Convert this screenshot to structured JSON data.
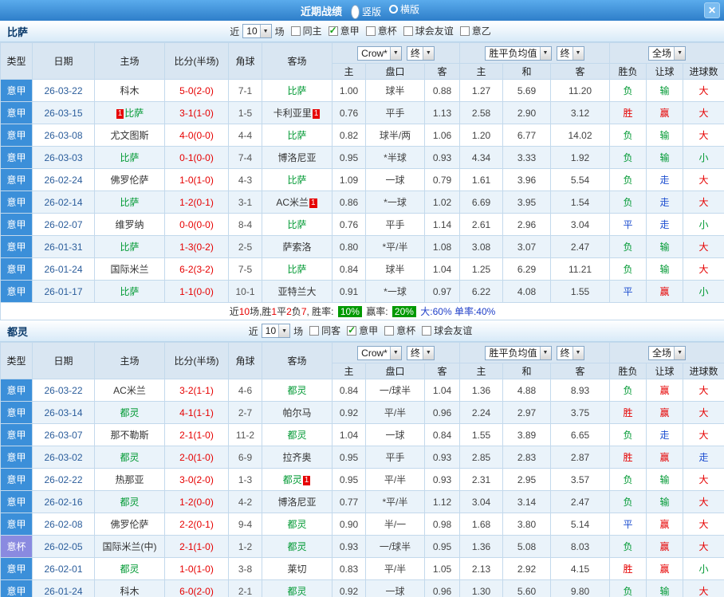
{
  "titlebar": {
    "title": "近期战绩",
    "layout_options": [
      {
        "label": "竖版",
        "selected": true
      },
      {
        "label": "横版",
        "selected": false
      }
    ],
    "close": "✕"
  },
  "colors": {
    "titlebar_blue": "#2e7ec9",
    "league_badge_blue": "#3b8fd9",
    "cup_badge_purple": "#8a8ae0",
    "focus_team_green": "#009933",
    "win_red": "#e60000",
    "loss_green": "#009933",
    "draw_blue": "#1e4fd0",
    "rate_badge_green": "#009900"
  },
  "sections": [
    {
      "team": "比萨",
      "filter": {
        "near": "近",
        "count": "10",
        "unit": "场",
        "checkboxes": [
          {
            "label": "同主",
            "checked": false
          },
          {
            "label": "意甲",
            "checked": true
          },
          {
            "label": "意杯",
            "checked": false
          },
          {
            "label": "球会友谊",
            "checked": false
          },
          {
            "label": "意乙",
            "checked": false
          }
        ]
      },
      "table": {
        "cols": [
          "类型",
          "日期",
          "主场",
          "比分(半场)",
          "角球",
          "客场"
        ],
        "odds_group": {
          "select": "Crow*",
          "final": "终",
          "cols": [
            "主",
            "盘口",
            "客"
          ]
        },
        "avg_group": {
          "select": "胜平负均值",
          "final": "终",
          "cols": [
            "主",
            "和",
            "客"
          ]
        },
        "full_group": {
          "select": "全场",
          "cols": [
            "胜负",
            "让球",
            "进球数"
          ]
        },
        "rows": [
          {
            "league": "意甲",
            "date": "26-03-22",
            "home": "科木",
            "score": "5-0(2-0)",
            "corner": "7-1",
            "away": "比萨",
            "af": true,
            "odds": [
              "1.00",
              "球半",
              "0.88"
            ],
            "avg": [
              "1.27",
              "5.69",
              "11.20"
            ],
            "res": [
              "负",
              "g"
            ],
            "let": [
              "输",
              "g"
            ],
            "big": [
              "大",
              "r"
            ]
          },
          {
            "league": "意甲",
            "date": "26-03-15",
            "home": "比萨",
            "hf": true,
            "hb_before": "1",
            "score": "3-1(1-0)",
            "corner": "1-5",
            "away": "卡利亚里",
            "ab_after": "1",
            "odds": [
              "0.76",
              "平手",
              "1.13"
            ],
            "avg": [
              "2.58",
              "2.90",
              "3.12"
            ],
            "res": [
              "胜",
              "r"
            ],
            "let": [
              "赢",
              "r"
            ],
            "big": [
              "大",
              "r"
            ]
          },
          {
            "league": "意甲",
            "date": "26-03-08",
            "home": "尤文图斯",
            "score": "4-0(0-0)",
            "corner": "4-4",
            "away": "比萨",
            "af": true,
            "odds": [
              "0.82",
              "球半/两",
              "1.06"
            ],
            "avg": [
              "1.20",
              "6.77",
              "14.02"
            ],
            "res": [
              "负",
              "g"
            ],
            "let": [
              "输",
              "g"
            ],
            "big": [
              "大",
              "r"
            ]
          },
          {
            "league": "意甲",
            "date": "26-03-03",
            "home": "比萨",
            "hf": true,
            "score": "0-1(0-0)",
            "corner": "7-4",
            "away": "博洛尼亚",
            "odds": [
              "0.95",
              "*半球",
              "0.93"
            ],
            "avg": [
              "4.34",
              "3.33",
              "1.92"
            ],
            "res": [
              "负",
              "g"
            ],
            "let": [
              "输",
              "g"
            ],
            "big": [
              "小",
              "g"
            ]
          },
          {
            "league": "意甲",
            "date": "26-02-24",
            "home": "佛罗伦萨",
            "score": "1-0(1-0)",
            "corner": "4-3",
            "away": "比萨",
            "af": true,
            "odds": [
              "1.09",
              "一球",
              "0.79"
            ],
            "avg": [
              "1.61",
              "3.96",
              "5.54"
            ],
            "res": [
              "负",
              "g"
            ],
            "let": [
              "走",
              "b"
            ],
            "big": [
              "大",
              "r"
            ]
          },
          {
            "league": "意甲",
            "date": "26-02-14",
            "home": "比萨",
            "hf": true,
            "score": "1-2(0-1)",
            "corner": "3-1",
            "away": "AC米兰",
            "ab_after": "1",
            "odds": [
              "0.86",
              "*一球",
              "1.02"
            ],
            "avg": [
              "6.69",
              "3.95",
              "1.54"
            ],
            "res": [
              "负",
              "g"
            ],
            "let": [
              "走",
              "b"
            ],
            "big": [
              "大",
              "r"
            ]
          },
          {
            "league": "意甲",
            "date": "26-02-07",
            "home": "维罗纳",
            "score": "0-0(0-0)",
            "corner": "8-4",
            "away": "比萨",
            "af": true,
            "odds": [
              "0.76",
              "平手",
              "1.14"
            ],
            "avg": [
              "2.61",
              "2.96",
              "3.04"
            ],
            "res": [
              "平",
              "b"
            ],
            "let": [
              "走",
              "b"
            ],
            "big": [
              "小",
              "g"
            ]
          },
          {
            "league": "意甲",
            "date": "26-01-31",
            "home": "比萨",
            "hf": true,
            "score": "1-3(0-2)",
            "corner": "2-5",
            "away": "萨索洛",
            "odds": [
              "0.80",
              "*平/半",
              "1.08"
            ],
            "avg": [
              "3.08",
              "3.07",
              "2.47"
            ],
            "res": [
              "负",
              "g"
            ],
            "let": [
              "输",
              "g"
            ],
            "big": [
              "大",
              "r"
            ]
          },
          {
            "league": "意甲",
            "date": "26-01-24",
            "home": "国际米兰",
            "score": "6-2(3-2)",
            "corner": "7-5",
            "away": "比萨",
            "af": true,
            "odds": [
              "0.84",
              "球半",
              "1.04"
            ],
            "avg": [
              "1.25",
              "6.29",
              "11.21"
            ],
            "res": [
              "负",
              "g"
            ],
            "let": [
              "输",
              "g"
            ],
            "big": [
              "大",
              "r"
            ]
          },
          {
            "league": "意甲",
            "date": "26-01-17",
            "home": "比萨",
            "hf": true,
            "score": "1-1(0-0)",
            "corner": "10-1",
            "away": "亚特兰大",
            "odds": [
              "0.91",
              "*一球",
              "0.97"
            ],
            "avg": [
              "6.22",
              "4.08",
              "1.55"
            ],
            "res": [
              "平",
              "b"
            ],
            "let": [
              "赢",
              "r"
            ],
            "big": [
              "小",
              "g"
            ]
          }
        ]
      },
      "summary": {
        "parts": [
          {
            "t": "近",
            "c": "k"
          },
          {
            "t": "10",
            "c": "r"
          },
          {
            "t": "场,胜",
            "c": "k"
          },
          {
            "t": "1",
            "c": "r"
          },
          {
            "t": "平",
            "c": "k"
          },
          {
            "t": "2",
            "c": "r"
          },
          {
            "t": "负",
            "c": "k"
          },
          {
            "t": "7",
            "c": "r"
          },
          {
            "t": ", 胜率: ",
            "c": "k"
          },
          {
            "t": "10%",
            "c": "badge"
          },
          {
            "t": " 赢率: ",
            "c": "k"
          },
          {
            "t": "20%",
            "c": "badge"
          },
          {
            "t": " 大:",
            "c": "bl"
          },
          {
            "t": "60%",
            "c": "bl"
          },
          {
            "t": " 单率:",
            "c": "bl"
          },
          {
            "t": "40%",
            "c": "bl"
          }
        ]
      }
    },
    {
      "team": "都灵",
      "filter": {
        "near": "近",
        "count": "10",
        "unit": "场",
        "checkboxes": [
          {
            "label": "同客",
            "checked": false
          },
          {
            "label": "意甲",
            "checked": true
          },
          {
            "label": "意杯",
            "checked": false
          },
          {
            "label": "球会友谊",
            "checked": false
          }
        ]
      },
      "table": {
        "cols": [
          "类型",
          "日期",
          "主场",
          "比分(半场)",
          "角球",
          "客场"
        ],
        "odds_group": {
          "select": "Crow*",
          "final": "终",
          "cols": [
            "主",
            "盘口",
            "客"
          ]
        },
        "avg_group": {
          "select": "胜平负均值",
          "final": "终",
          "cols": [
            "主",
            "和",
            "客"
          ]
        },
        "full_group": {
          "select": "全场",
          "cols": [
            "胜负",
            "让球",
            "进球数"
          ]
        },
        "rows": [
          {
            "league": "意甲",
            "date": "26-03-22",
            "home": "AC米兰",
            "score": "3-2(1-1)",
            "corner": "4-6",
            "away": "都灵",
            "af": true,
            "odds": [
              "0.84",
              "一/球半",
              "1.04"
            ],
            "avg": [
              "1.36",
              "4.88",
              "8.93"
            ],
            "res": [
              "负",
              "g"
            ],
            "let": [
              "赢",
              "r"
            ],
            "big": [
              "大",
              "r"
            ]
          },
          {
            "league": "意甲",
            "date": "26-03-14",
            "home": "都灵",
            "hf": true,
            "score": "4-1(1-1)",
            "corner": "2-7",
            "away": "帕尔马",
            "odds": [
              "0.92",
              "平/半",
              "0.96"
            ],
            "avg": [
              "2.24",
              "2.97",
              "3.75"
            ],
            "res": [
              "胜",
              "r"
            ],
            "let": [
              "赢",
              "r"
            ],
            "big": [
              "大",
              "r"
            ]
          },
          {
            "league": "意甲",
            "date": "26-03-07",
            "home": "那不勒斯",
            "score": "2-1(1-0)",
            "corner": "11-2",
            "away": "都灵",
            "af": true,
            "odds": [
              "1.04",
              "一球",
              "0.84"
            ],
            "avg": [
              "1.55",
              "3.89",
              "6.65"
            ],
            "res": [
              "负",
              "g"
            ],
            "let": [
              "走",
              "b"
            ],
            "big": [
              "大",
              "r"
            ]
          },
          {
            "league": "意甲",
            "date": "26-03-02",
            "home": "都灵",
            "hf": true,
            "score": "2-0(1-0)",
            "corner": "6-9",
            "away": "拉齐奥",
            "odds": [
              "0.95",
              "平手",
              "0.93"
            ],
            "avg": [
              "2.85",
              "2.83",
              "2.87"
            ],
            "res": [
              "胜",
              "r"
            ],
            "let": [
              "赢",
              "r"
            ],
            "big": [
              "走",
              "b"
            ]
          },
          {
            "league": "意甲",
            "date": "26-02-22",
            "home": "热那亚",
            "score": "3-0(2-0)",
            "corner": "1-3",
            "away": "都灵",
            "af": true,
            "ab_after": "1",
            "odds": [
              "0.95",
              "平/半",
              "0.93"
            ],
            "avg": [
              "2.31",
              "2.95",
              "3.57"
            ],
            "res": [
              "负",
              "g"
            ],
            "let": [
              "输",
              "g"
            ],
            "big": [
              "大",
              "r"
            ]
          },
          {
            "league": "意甲",
            "date": "26-02-16",
            "home": "都灵",
            "hf": true,
            "score": "1-2(0-0)",
            "corner": "4-2",
            "away": "博洛尼亚",
            "odds": [
              "0.77",
              "*平/半",
              "1.12"
            ],
            "avg": [
              "3.04",
              "3.14",
              "2.47"
            ],
            "res": [
              "负",
              "g"
            ],
            "let": [
              "输",
              "g"
            ],
            "big": [
              "大",
              "r"
            ]
          },
          {
            "league": "意甲",
            "date": "26-02-08",
            "home": "佛罗伦萨",
            "score": "2-2(0-1)",
            "corner": "9-4",
            "away": "都灵",
            "af": true,
            "odds": [
              "0.90",
              "半/一",
              "0.98"
            ],
            "avg": [
              "1.68",
              "3.80",
              "5.14"
            ],
            "res": [
              "平",
              "b"
            ],
            "let": [
              "赢",
              "r"
            ],
            "big": [
              "大",
              "r"
            ]
          },
          {
            "league": "意杯",
            "cup": true,
            "date": "26-02-05",
            "home": "国际米兰(中)",
            "score": "2-1(1-0)",
            "corner": "1-2",
            "away": "都灵",
            "af": true,
            "odds": [
              "0.93",
              "一/球半",
              "0.95"
            ],
            "avg": [
              "1.36",
              "5.08",
              "8.03"
            ],
            "res": [
              "负",
              "g"
            ],
            "let": [
              "赢",
              "r"
            ],
            "big": [
              "大",
              "r"
            ]
          },
          {
            "league": "意甲",
            "date": "26-02-01",
            "home": "都灵",
            "hf": true,
            "score": "1-0(1-0)",
            "corner": "3-8",
            "away": "莱切",
            "odds": [
              "0.83",
              "平/半",
              "1.05"
            ],
            "avg": [
              "2.13",
              "2.92",
              "4.15"
            ],
            "res": [
              "胜",
              "r"
            ],
            "let": [
              "赢",
              "r"
            ],
            "big": [
              "小",
              "g"
            ]
          },
          {
            "league": "意甲",
            "date": "26-01-24",
            "home": "科木",
            "score": "6-0(2-0)",
            "corner": "2-1",
            "away": "都灵",
            "af": true,
            "odds": [
              "0.92",
              "一球",
              "0.96"
            ],
            "avg": [
              "1.30",
              "5.60",
              "9.80"
            ],
            "res": [
              "负",
              "g"
            ],
            "let": [
              "输",
              "g"
            ],
            "big": [
              "大",
              "r"
            ]
          }
        ]
      },
      "summary": null
    }
  ]
}
